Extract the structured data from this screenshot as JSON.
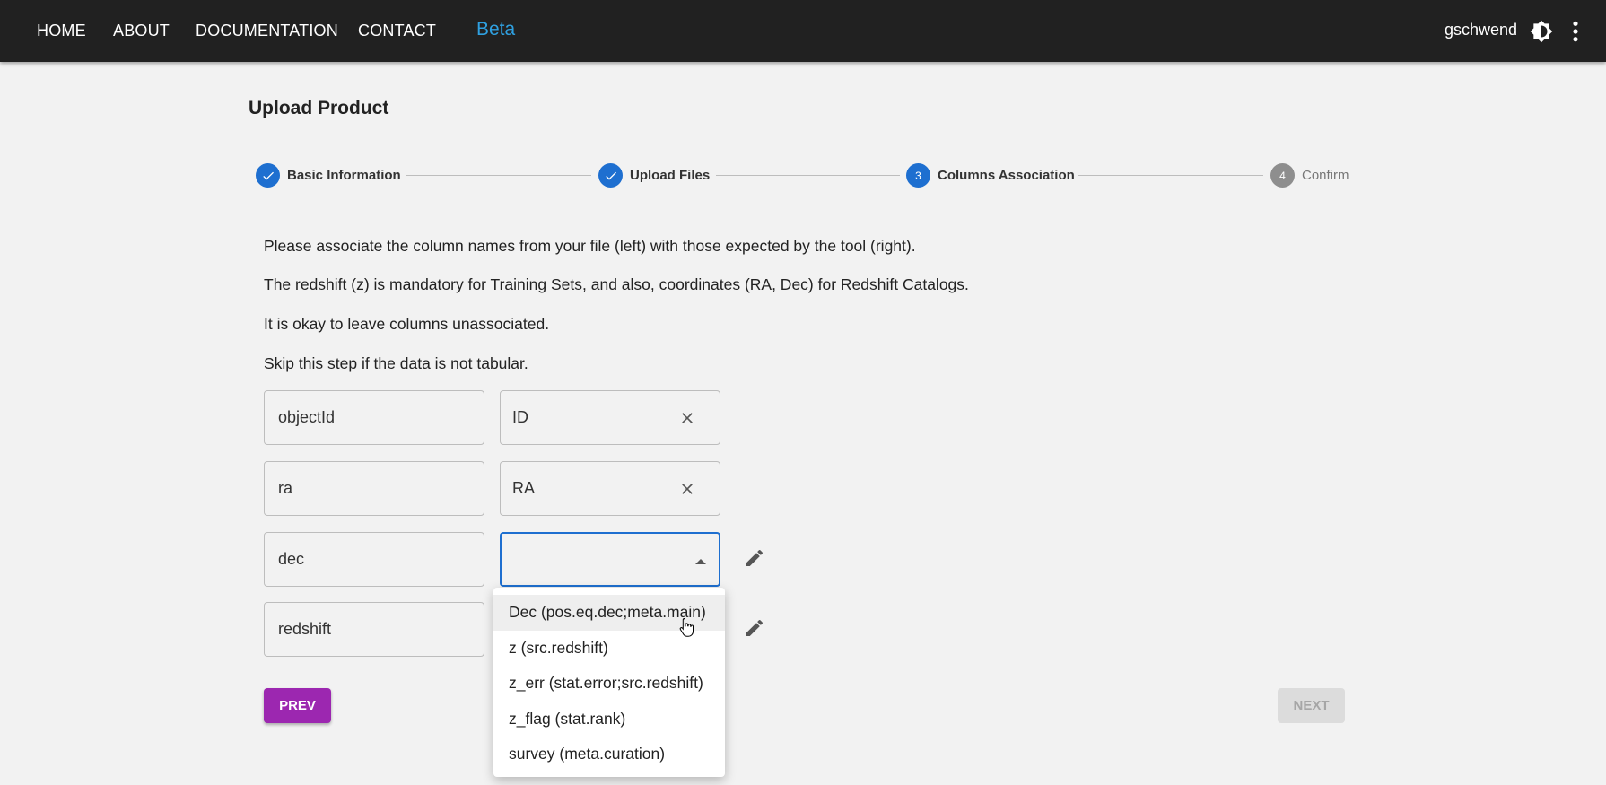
{
  "navbar": {
    "links": [
      "HOME",
      "ABOUT",
      "DOCUMENTATION",
      "CONTACT"
    ],
    "badge": "Beta",
    "username": "gschwend",
    "icons": [
      "theme-toggle-icon",
      "more-vert-icon"
    ]
  },
  "page": {
    "title": "Upload Product"
  },
  "stepper": {
    "steps": [
      {
        "label": "Basic Information",
        "state": "completed",
        "marker": ""
      },
      {
        "label": "Upload Files",
        "state": "completed",
        "marker": ""
      },
      {
        "label": "Columns Association",
        "state": "active",
        "marker": "3"
      },
      {
        "label": "Confirm",
        "state": "inactive",
        "marker": "4"
      }
    ],
    "colors": {
      "active": "#1e6fd0",
      "inactive": "#8e8e8e"
    }
  },
  "instructions": [
    "Please associate the column names from your file (left) with those expected by the tool (right).",
    "The redshift (z) is mandatory for Training Sets, and also, coordinates (RA, Dec) for Redshift Catalogs.",
    "It is okay to leave columns unassociated.",
    "Skip this step if the data is not tabular."
  ],
  "associations": [
    {
      "column": "objectId",
      "value": "ID"
    },
    {
      "column": "ra",
      "value": "RA"
    },
    {
      "column": "dec",
      "value": ""
    },
    {
      "column": "redshift",
      "value": ""
    }
  ],
  "dropdown": {
    "options": [
      "Dec (pos.eq.dec;meta.main)",
      "z (src.redshift)",
      "z_err (stat.error;src.redshift)",
      "z_flag (stat.rank)",
      "survey (meta.curation)"
    ],
    "highlighted": "Dec (pos.eq.dec;meta.main)"
  },
  "buttons": {
    "prev": "PREV",
    "next": "NEXT",
    "prev_color": "#9c27b0"
  }
}
